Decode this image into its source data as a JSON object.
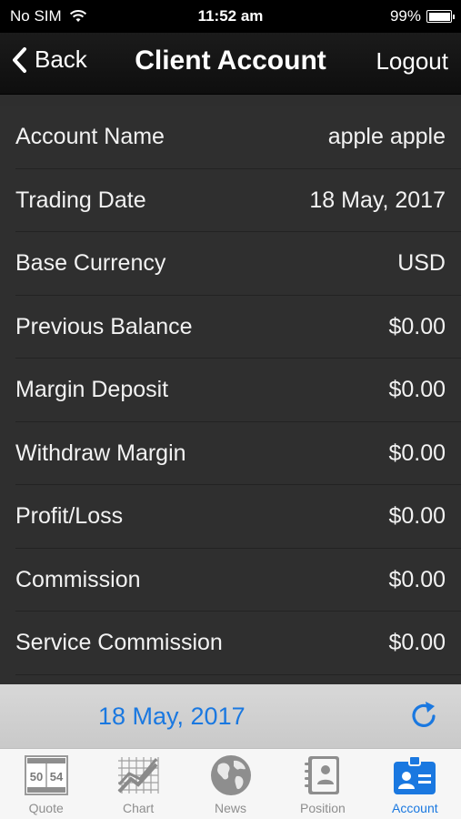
{
  "status_bar": {
    "carrier": "No SIM",
    "time": "11:52 am",
    "battery": "99%"
  },
  "nav": {
    "back_label": "Back",
    "title": "Client Account",
    "logout_label": "Logout"
  },
  "account": {
    "rows": [
      {
        "label": "Account Name",
        "value": "apple apple"
      },
      {
        "label": "Trading Date",
        "value": "18 May, 2017"
      },
      {
        "label": "Base Currency",
        "value": "USD"
      },
      {
        "label": "Previous Balance",
        "value": "$0.00"
      },
      {
        "label": "Margin Deposit",
        "value": "$0.00"
      },
      {
        "label": "Withdraw Margin",
        "value": "$0.00"
      },
      {
        "label": "Profit/Loss",
        "value": "$0.00"
      },
      {
        "label": "Commission",
        "value": "$0.00"
      },
      {
        "label": "Service Commission",
        "value": "$0.00"
      }
    ]
  },
  "date_bar": {
    "date": "18 May, 2017"
  },
  "tabs": [
    {
      "label": "Quote",
      "icon": "quote-board-icon",
      "quote_numbers": [
        "50",
        "54"
      ],
      "active": false
    },
    {
      "label": "Chart",
      "icon": "chart-icon",
      "active": false
    },
    {
      "label": "News",
      "icon": "globe-icon",
      "active": false
    },
    {
      "label": "Position",
      "icon": "contact-book-icon",
      "active": false
    },
    {
      "label": "Account",
      "icon": "id-badge-icon",
      "active": true
    }
  ],
  "colors": {
    "accent": "#1a78e0",
    "inactive_tab": "#8e8e8e",
    "background": "#2f2f2f"
  }
}
